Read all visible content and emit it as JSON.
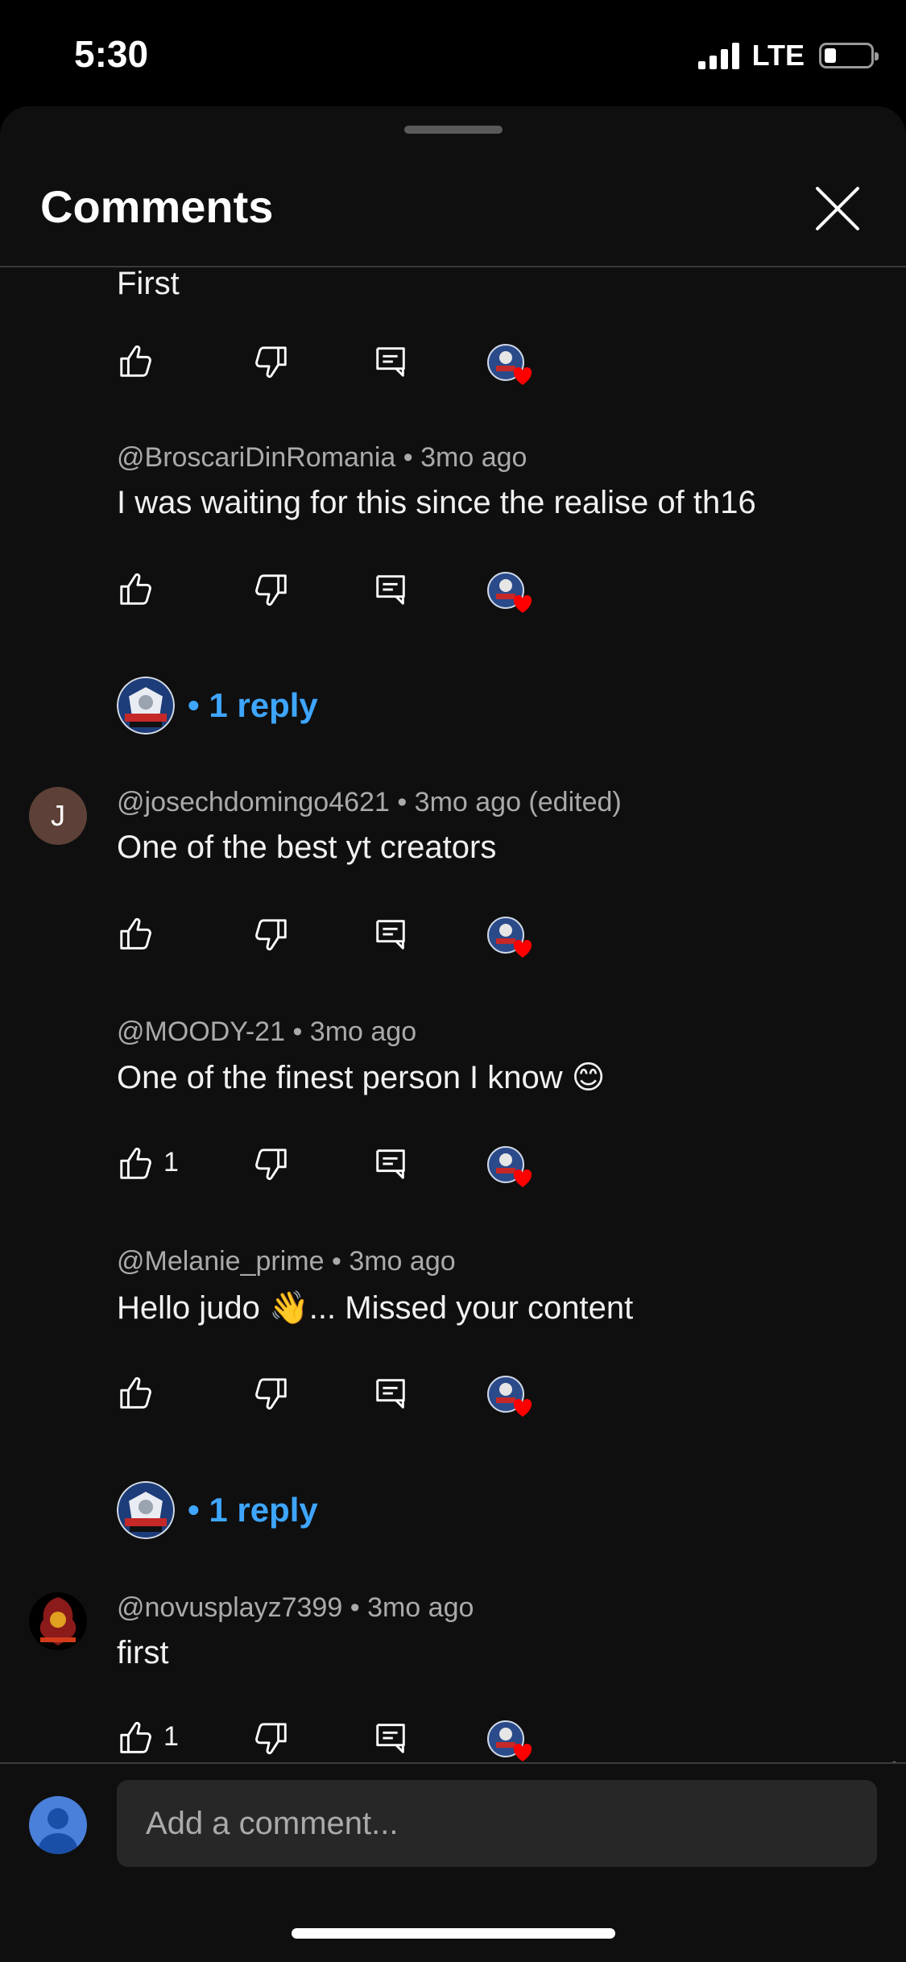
{
  "status": {
    "time": "5:30",
    "network": "LTE"
  },
  "header": {
    "title": "Comments"
  },
  "comments": [
    {
      "text": "First",
      "likes": ""
    },
    {
      "author": "@BroscariDinRomania",
      "age": "3mo ago",
      "text": "I was waiting for this since the realise of th16",
      "likes": ""
    },
    {
      "reply_label": "• 1 reply"
    },
    {
      "avatar_letter": "J",
      "author": "@josechdomingo4621",
      "age": "3mo ago (edited)",
      "text": "One of the best yt creators",
      "likes": ""
    },
    {
      "author": "@MOODY-21",
      "age": "3mo ago",
      "text": "One of the finest person I know 😊",
      "likes": "1"
    },
    {
      "author": "@Melanie_prime",
      "age": "3mo ago",
      "text": "Hello judo 👋... Missed your content",
      "likes": ""
    },
    {
      "reply_label": "• 1 reply"
    },
    {
      "author": "@novusplayz7399",
      "age": "3mo ago",
      "text": "first",
      "likes": "1"
    }
  ],
  "composer": {
    "placeholder": "Add a comment..."
  },
  "colors": {
    "accent": "#3ea6ff",
    "heart": "#ff0000",
    "background": "#0f0f0f"
  }
}
